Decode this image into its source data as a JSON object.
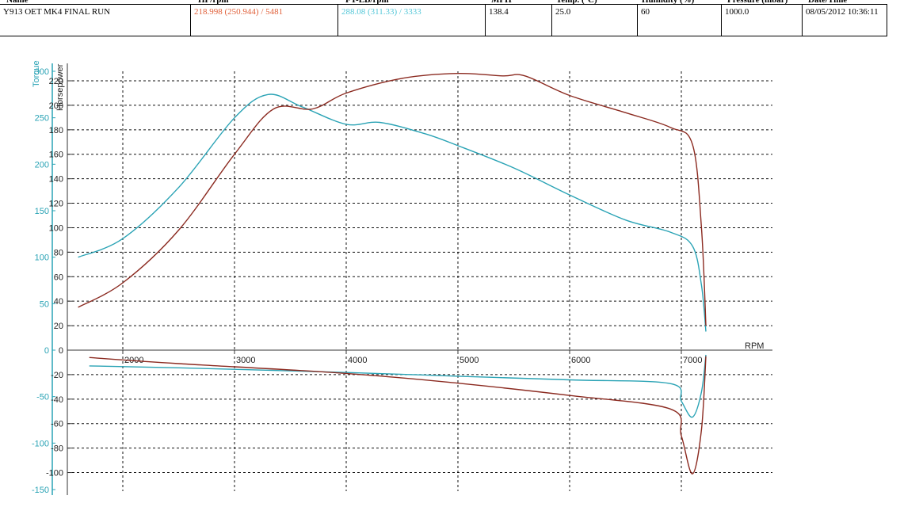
{
  "header": {
    "columns": [
      "Name",
      "HP/rpm",
      "FT-LB/rpm",
      "MPH",
      "Temp. (°C)",
      "Humidity (%)",
      "Pressure (mbar)",
      "Date/Time"
    ],
    "row": {
      "name": "Y913 OET MK4 FINAL RUN",
      "hp_rpm": "218.998 (250.944) / 5481",
      "ftlb_rpm": "288.08 (311.33) / 3333",
      "mph": "138.4",
      "temp": "25.0",
      "humidity": "60",
      "pressure": "1000.0",
      "datetime": "08/05/2012 10:36:11"
    },
    "colors": {
      "hp": "#e0603a",
      "ftlb": "#55c7d8"
    }
  },
  "chart_data": {
    "type": "line",
    "xlabel": "RPM",
    "ylabel_left_outer": "Torque",
    "ylabel_left_inner": "Horsepower",
    "x_ticks": [
      2000,
      3000,
      4000,
      5000,
      6000,
      7000
    ],
    "xlim": [
      1600,
      7800
    ],
    "torque_ticks": [
      -150,
      -100,
      -50,
      0,
      50,
      100,
      150,
      200,
      250,
      300
    ],
    "torque_tick_labels": [
      "-150",
      "-100",
      "-50",
      "0",
      "50",
      "100",
      "150",
      "200",
      "250",
      "300"
    ],
    "torque_lim": [
      -150,
      300
    ],
    "hp_ticks": [
      -100,
      -80,
      -60,
      -40,
      -20,
      0,
      20,
      40,
      60,
      80,
      100,
      120,
      140,
      160,
      180,
      200,
      220
    ],
    "hp_tick_labels": [
      "-100",
      "-80",
      "-60",
      "-40",
      "-20",
      "0",
      "20",
      "40",
      "60",
      "80",
      "100",
      "120",
      "140",
      "160",
      "180",
      "200",
      "220"
    ],
    "hp_lim": [
      -110,
      230
    ],
    "grid": true,
    "series": [
      {
        "color": "#2aa3b5",
        "axis": "torque",
        "points": [
          [
            1600,
            100
          ],
          [
            2000,
            120
          ],
          [
            2500,
            175
          ],
          [
            3000,
            250
          ],
          [
            3300,
            275
          ],
          [
            3600,
            262
          ],
          [
            4000,
            243
          ],
          [
            4300,
            245
          ],
          [
            4700,
            233
          ],
          [
            5000,
            220
          ],
          [
            5500,
            196
          ],
          [
            6000,
            167
          ],
          [
            6500,
            140
          ],
          [
            6900,
            127
          ],
          [
            7100,
            112
          ],
          [
            7180,
            70
          ],
          [
            7220,
            20
          ]
        ]
      },
      {
        "color": "#8b2a20",
        "axis": "hp",
        "points": [
          [
            1600,
            35
          ],
          [
            2000,
            55
          ],
          [
            2500,
            98
          ],
          [
            3000,
            160
          ],
          [
            3350,
            197
          ],
          [
            3700,
            197
          ],
          [
            4000,
            210
          ],
          [
            4500,
            222
          ],
          [
            5000,
            226
          ],
          [
            5400,
            224
          ],
          [
            5600,
            224
          ],
          [
            6000,
            208
          ],
          [
            6500,
            194
          ],
          [
            6900,
            182
          ],
          [
            7100,
            168
          ],
          [
            7180,
            100
          ],
          [
            7220,
            20
          ]
        ]
      },
      {
        "color": "#2aa3b5",
        "axis": "torque",
        "points": [
          [
            1700,
            -17
          ],
          [
            2500,
            -19
          ],
          [
            4000,
            -24
          ],
          [
            5000,
            -28
          ],
          [
            6000,
            -32
          ],
          [
            6900,
            -36
          ],
          [
            7000,
            -55
          ],
          [
            7100,
            -72
          ],
          [
            7180,
            -45
          ],
          [
            7220,
            -5
          ]
        ]
      },
      {
        "color": "#8b2a20",
        "axis": "hp",
        "points": [
          [
            1700,
            -6
          ],
          [
            2500,
            -11
          ],
          [
            4000,
            -19
          ],
          [
            5000,
            -27
          ],
          [
            6000,
            -37
          ],
          [
            6900,
            -48
          ],
          [
            7000,
            -70
          ],
          [
            7100,
            -101
          ],
          [
            7180,
            -65
          ],
          [
            7220,
            -5
          ]
        ]
      }
    ]
  }
}
